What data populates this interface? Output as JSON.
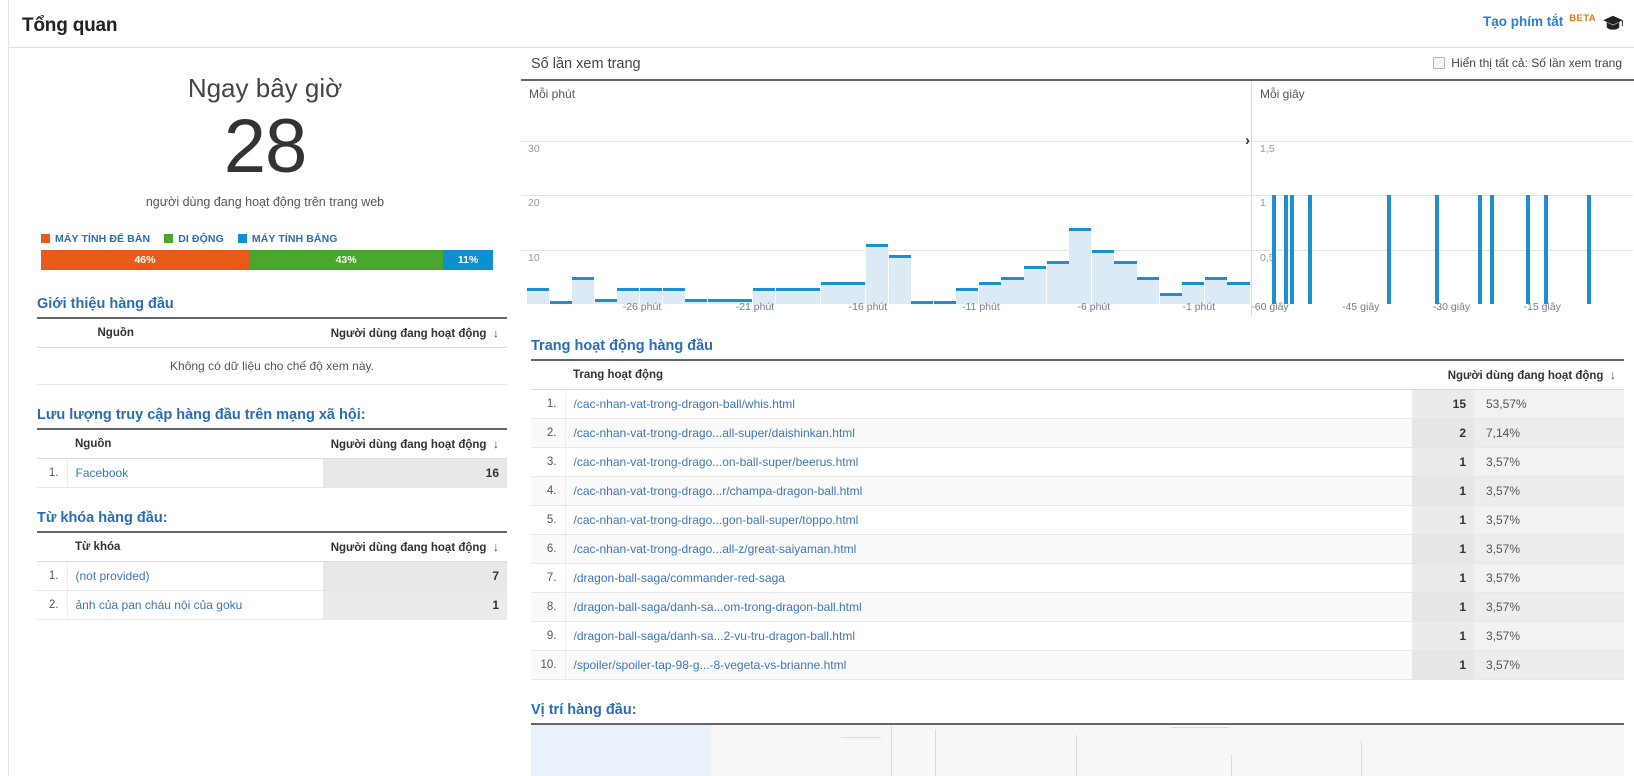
{
  "header": {
    "title": "Tổng quan",
    "shortcut_label": "Tạo phím tắt",
    "beta_badge": "BETA",
    "cap_icon": "graduation-cap-icon"
  },
  "realtime": {
    "right_now_label": "Ngay bây giờ",
    "active_users": "28",
    "active_users_caption": "người dùng đang hoạt động trên trang web",
    "devices": [
      {
        "label": "MÁY TÍNH ĐỂ BÀN",
        "percent": "46%",
        "value": 46,
        "color": "#ea5b1b"
      },
      {
        "label": "DI ĐỘNG",
        "percent": "43%",
        "value": 43,
        "color": "#4aa72e"
      },
      {
        "label": "MÁY TÍNH BẢNG",
        "percent": "11%",
        "value": 11,
        "color": "#0e8fd0"
      }
    ]
  },
  "referrals": {
    "title": "Giới thiệu hàng đầu",
    "columns": [
      "Nguồn",
      "Người dùng đang hoạt động"
    ],
    "sort_icon": "sort-descending-arrow",
    "empty_message": "Không có dữ liệu cho chế độ xem này.",
    "rows": []
  },
  "social": {
    "title": "Lưu lượng truy cập hàng đầu trên mạng xã hội:",
    "columns": [
      "Nguồn",
      "Người dùng đang hoạt động"
    ],
    "sort_icon": "sort-descending-arrow",
    "rows": [
      {
        "index": "1.",
        "source": "Facebook",
        "users": "16"
      }
    ]
  },
  "keywords": {
    "title": "Từ khóa hàng đầu:",
    "columns": [
      "Từ khóa",
      "Người dùng đang hoạt động"
    ],
    "sort_icon": "sort-descending-arrow",
    "rows": [
      {
        "index": "1.",
        "keyword": "(not provided)",
        "users": "7"
      },
      {
        "index": "2.",
        "keyword": "ảnh của pan cháu nội của goku",
        "users": "1"
      }
    ]
  },
  "pages": {
    "title": "Trang hoạt động hàng đầu",
    "columns": [
      "Trang hoạt động",
      "Người dùng đang hoạt động"
    ],
    "sort_icon": "sort-descending-arrow",
    "rows": [
      {
        "index": "1.",
        "page": "/cac-nhan-vat-trong-dragon-ball/whis.html",
        "users": "15",
        "percent": "53,57%"
      },
      {
        "index": "2.",
        "page": "/cac-nhan-vat-trong-drago...all-super/daishinkan.html",
        "users": "2",
        "percent": "7,14%"
      },
      {
        "index": "3.",
        "page": "/cac-nhan-vat-trong-drago...on-ball-super/beerus.html",
        "users": "1",
        "percent": "3,57%"
      },
      {
        "index": "4.",
        "page": "/cac-nhan-vat-trong-drago...r/champa-dragon-ball.html",
        "users": "1",
        "percent": "3,57%"
      },
      {
        "index": "5.",
        "page": "/cac-nhan-vat-trong-drago...gon-ball-super/toppo.html",
        "users": "1",
        "percent": "3,57%"
      },
      {
        "index": "6.",
        "page": "/cac-nhan-vat-trong-drago...all-z/great-saiyaman.html",
        "users": "1",
        "percent": "3,57%"
      },
      {
        "index": "7.",
        "page": "/dragon-ball-saga/commander-red-saga",
        "users": "1",
        "percent": "3,57%"
      },
      {
        "index": "8.",
        "page": "/dragon-ball-saga/danh-sa...om-trong-dragon-ball.html",
        "users": "1",
        "percent": "3,57%"
      },
      {
        "index": "9.",
        "page": "/dragon-ball-saga/danh-sa...2-vu-tru-dragon-ball.html",
        "users": "1",
        "percent": "3,57%"
      },
      {
        "index": "10.",
        "page": "/spoiler/spoiler-tap-98-g...-8-vegeta-vs-brianne.html",
        "users": "1",
        "percent": "3,57%"
      }
    ]
  },
  "locations": {
    "title": "Vị trí hàng đầu:"
  },
  "chart_data": [
    {
      "type": "bar",
      "title": "Số lần xem trang",
      "subtitle": "Mỗi phút",
      "checkbox_label": "Hiển thị tất cả: Số lần xem trang",
      "checkbox_checked": false,
      "xlabel": "",
      "ylabel": "",
      "ylim": [
        0,
        35
      ],
      "yticks": [
        "10",
        "20",
        "30"
      ],
      "ytick_values": [
        10,
        20,
        30
      ],
      "grid": true,
      "xticks": [
        "-26 phút",
        "-21 phút",
        "-16 phút",
        "-11 phút",
        "-6 phút",
        "-1 phút"
      ],
      "xtick_positions": [
        5,
        10,
        15,
        20,
        25,
        30
      ],
      "categories": [
        "-30",
        "-29",
        "-28",
        "-27",
        "-26",
        "-25",
        "-24",
        "-23",
        "-22",
        "-21",
        "-20",
        "-19",
        "-18",
        "-17",
        "-16",
        "-15",
        "-14",
        "-13",
        "-12",
        "-11",
        "-10",
        "-9",
        "-8",
        "-7",
        "-6",
        "-5",
        "-4",
        "-3",
        "-2",
        "-1"
      ],
      "values": [
        3,
        0,
        5,
        1,
        3,
        3,
        3,
        1,
        1,
        1,
        3,
        3,
        3,
        4,
        4,
        11,
        9,
        0,
        0,
        3,
        4,
        5,
        7,
        8,
        14,
        10,
        8,
        5,
        2,
        4,
        5,
        4
      ],
      "bar_color": "#1a8fd1",
      "fill_color": "#dbeaf4"
    },
    {
      "type": "bar",
      "title": "Số lần xem trang",
      "subtitle": "Mỗi giây",
      "xlabel": "",
      "ylabel": "",
      "ylim": [
        0,
        1.75
      ],
      "yticks": [
        "0,5",
        "1",
        "1,5"
      ],
      "ytick_values": [
        0.5,
        1,
        1.5
      ],
      "grid": true,
      "xticks": [
        "-60 giây",
        "-45 giây",
        "-30 giây",
        "-15 giây"
      ],
      "xtick_positions": [
        0,
        15,
        30,
        45
      ],
      "spike_seconds": [
        -59,
        -57,
        -56,
        -53,
        -40,
        -32,
        -25,
        -23,
        -17,
        -14,
        -7
      ],
      "spike_value": 1,
      "bar_color": "#1a8fd1"
    }
  ]
}
